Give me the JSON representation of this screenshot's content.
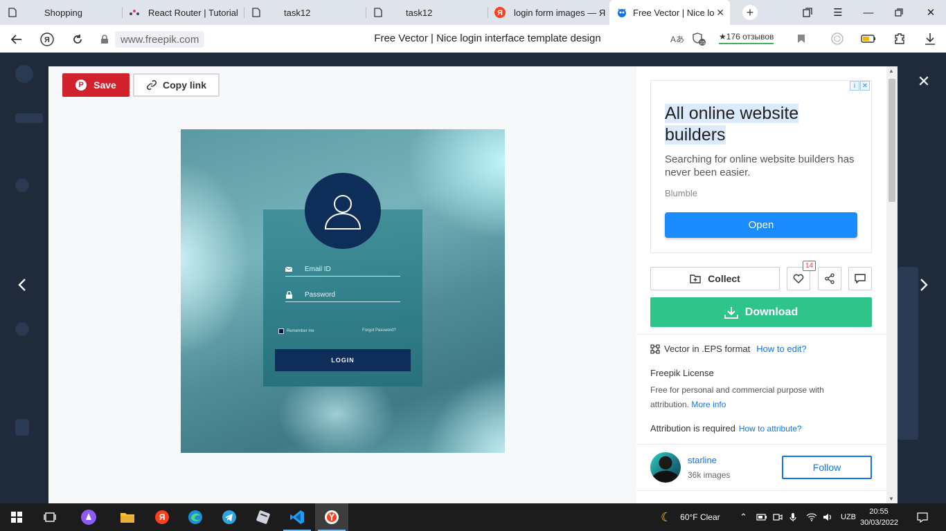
{
  "browser": {
    "tabs": [
      {
        "title": "Shopping"
      },
      {
        "title": "React Router | Tutorial"
      },
      {
        "title": "task12"
      },
      {
        "title": "task12"
      },
      {
        "title": "login form images — Я"
      },
      {
        "title": "Free Vector | Nice lo"
      }
    ],
    "url": "www.freepik.com",
    "page_title": "Free Vector | Nice login interface template design",
    "reviews": "★176 отзывов"
  },
  "toolbar": {
    "save_label": "Save",
    "copy_link_label": "Copy link"
  },
  "preview": {
    "email_placeholder": "Email ID",
    "password_placeholder": "Password",
    "remember_label": "Remember me",
    "forgot_label": "Forgot Password?",
    "login_label": "LOGIN"
  },
  "ad": {
    "title_line1": "All online website",
    "title_line2": "builders",
    "description": "Searching for online website builders has never been easier.",
    "brand": "Blumble",
    "cta": "Open"
  },
  "actions": {
    "collect_label": "Collect",
    "like_count": "14",
    "download_label": "Download"
  },
  "details": {
    "format_label": "Vector in .EPS format",
    "how_to_edit": "How to edit?",
    "license_title": "Freepik License",
    "license_text": "Free for personal and commercial purpose with attribution.",
    "more_info": "More info",
    "attribution_label": "Attribution is required",
    "how_to_attribute": "How to attribute?"
  },
  "author": {
    "name": "starline",
    "images": "36k images",
    "follow_label": "Follow"
  },
  "taskbar": {
    "weather": "60°F  Clear",
    "language": "UZB",
    "time": "20:55",
    "date": "30/03/2022"
  },
  "colors": {
    "save_red": "#d0212d",
    "download_green": "#2ec48a",
    "link_blue": "#1273eb",
    "ad_button": "#1a8cff",
    "login_navy": "#0e2e59"
  }
}
